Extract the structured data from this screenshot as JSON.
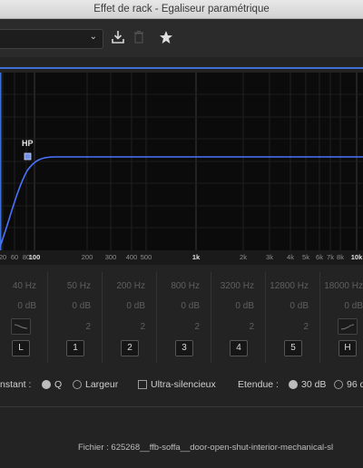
{
  "window": {
    "title": "Effet de rack - Egaliseur paramétrique"
  },
  "toolbar": {
    "preset_value": "",
    "icons": [
      "chevron-down-icon",
      "download-icon",
      "trash-icon",
      "star-icon"
    ]
  },
  "graph": {
    "marker_label": "HP",
    "curve_color": "#4a73ff",
    "freq_labels": [
      "20",
      "60",
      "80",
      "100",
      "200",
      "300",
      "400",
      "500",
      "1k",
      "2k",
      "3k",
      "4k",
      "5k",
      "6k",
      "7k",
      "8k",
      "10k"
    ]
  },
  "bands": [
    {
      "freq": "40 Hz",
      "gain": "0 dB",
      "q": "",
      "button": "L"
    },
    {
      "freq": "50 Hz",
      "gain": "0 dB",
      "q": "2",
      "button": "1"
    },
    {
      "freq": "200 Hz",
      "gain": "0 dB",
      "q": "2",
      "button": "2"
    },
    {
      "freq": "800 Hz",
      "gain": "0 dB",
      "q": "2",
      "button": "3"
    },
    {
      "freq": "3200 Hz",
      "gain": "0 dB",
      "q": "2",
      "button": "4"
    },
    {
      "freq": "12800 Hz",
      "gain": "0 dB",
      "q": "2",
      "button": "5"
    },
    {
      "freq": "18000 Hz",
      "gain": "0 dB",
      "q": "",
      "button": "H"
    }
  ],
  "options": {
    "constant_label": "nstant :",
    "q_label": "Q",
    "width_label": "Largeur",
    "ultra_quiet_label": "Ultra-silencieux",
    "range_label": "Etendue :",
    "range_30": "30 dB",
    "range_96": "96 d"
  },
  "footer": {
    "file": "Fichier : 625268__ffb-soffa__door-open-shut-interior-mechanical-sl"
  }
}
